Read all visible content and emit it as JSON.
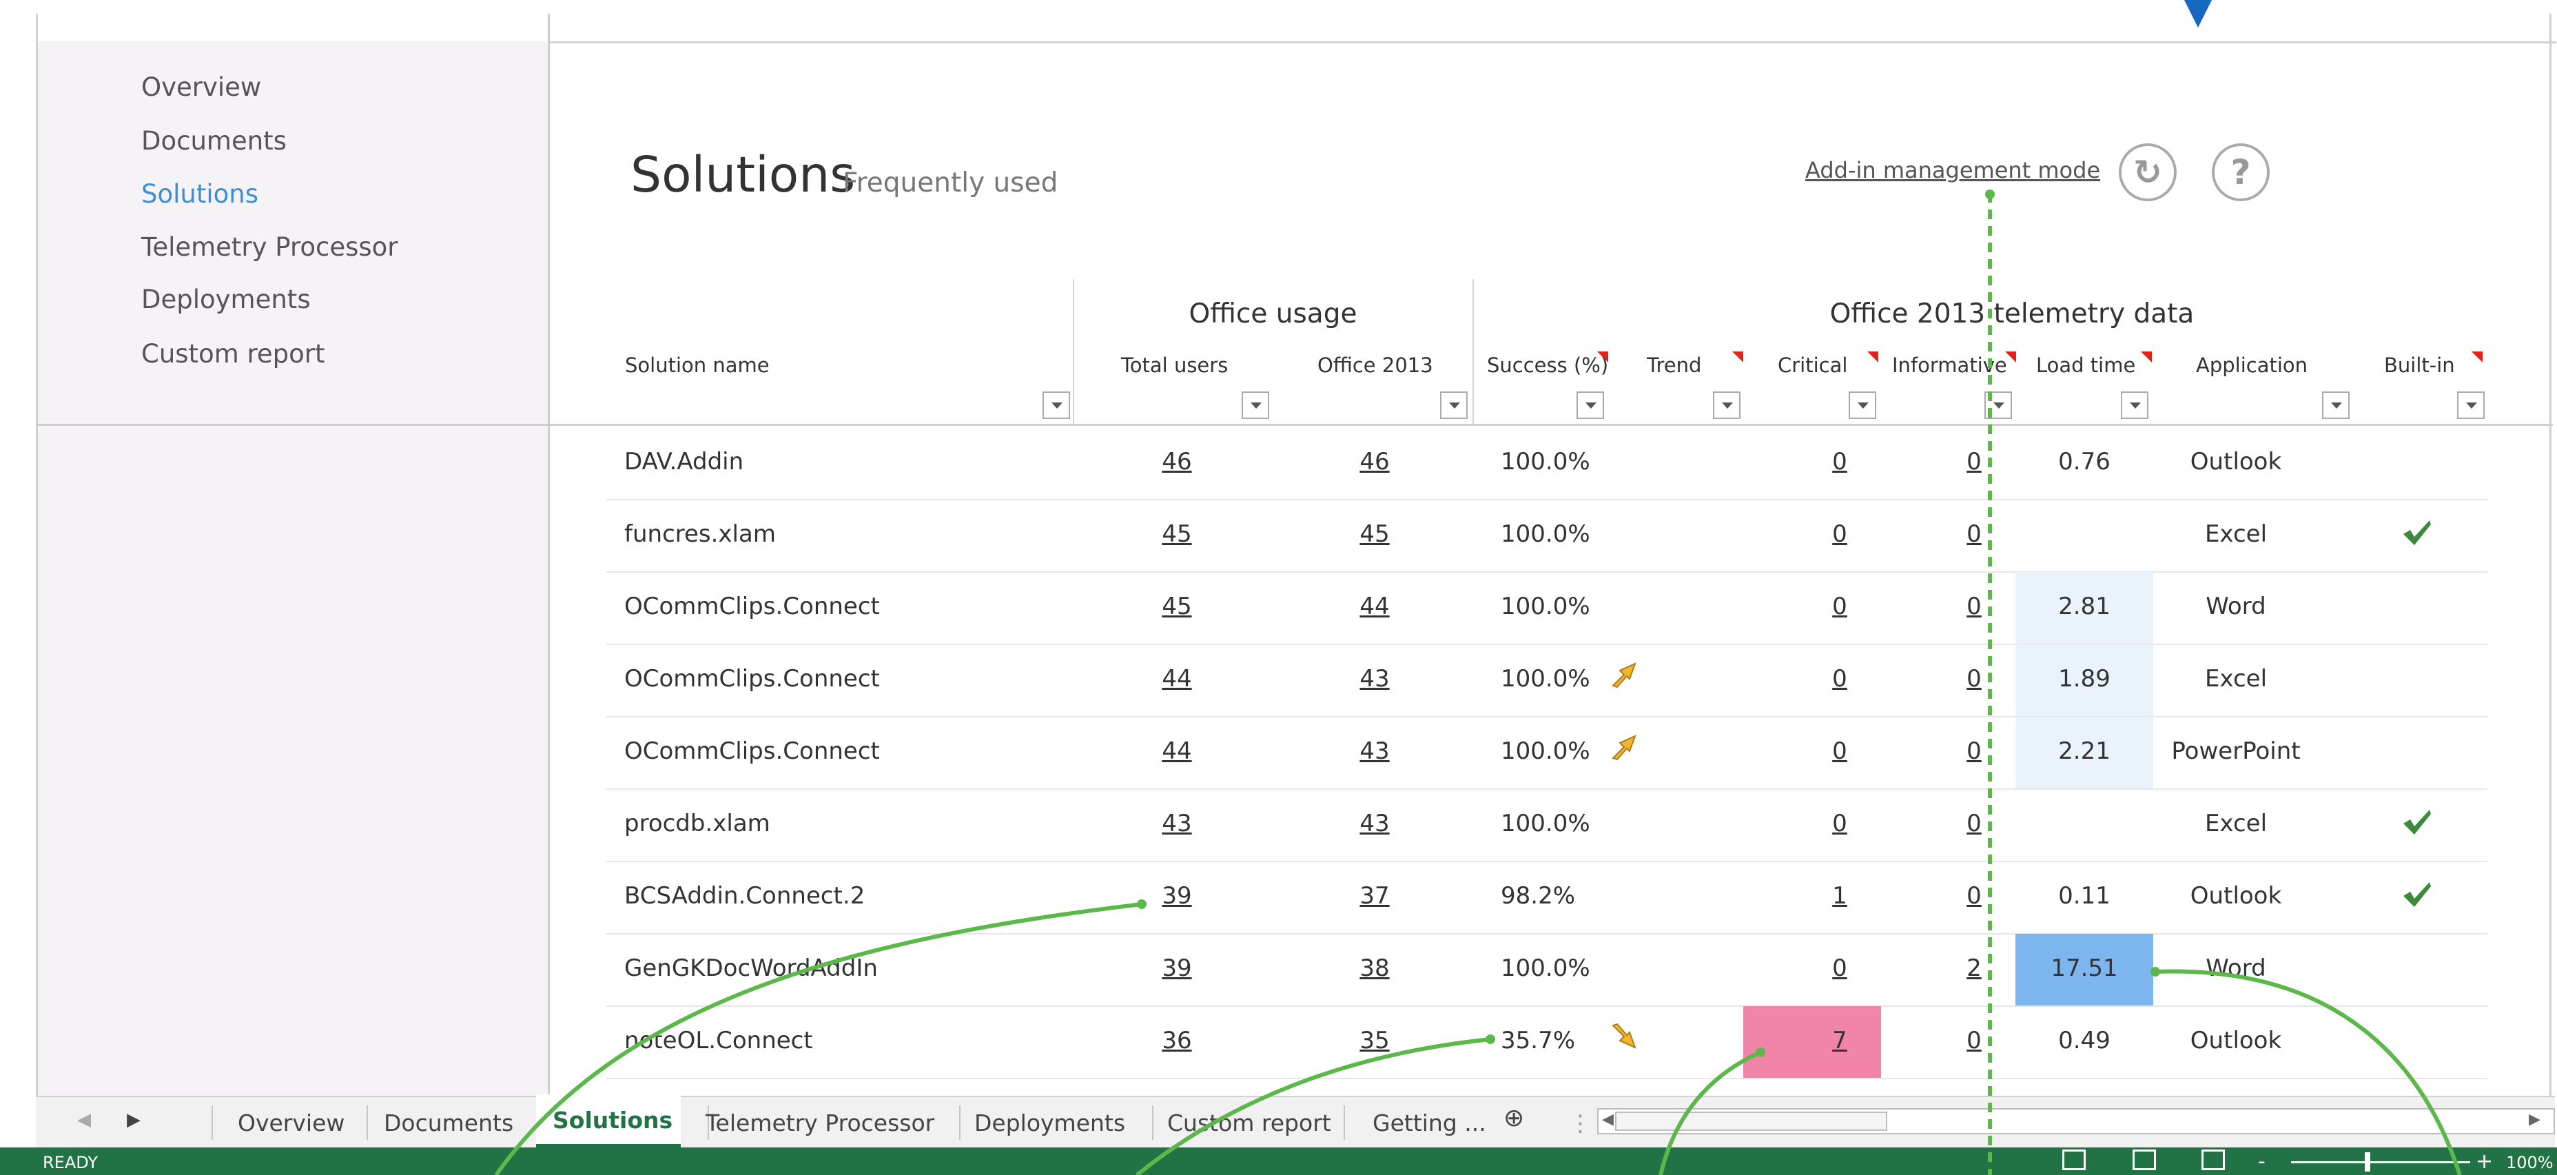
{
  "nav": {
    "items": [
      {
        "label": "Overview",
        "active": false
      },
      {
        "label": "Documents",
        "active": false
      },
      {
        "label": "Solutions",
        "active": true
      },
      {
        "label": "Telemetry Processor",
        "active": false
      },
      {
        "label": "Deployments",
        "active": false
      },
      {
        "label": "Custom report",
        "active": false
      }
    ]
  },
  "header": {
    "title": "Solutions",
    "subtitle": "Frequently used",
    "addin_mode_link": "Add-in management mode",
    "refresh_icon": "refresh-icon",
    "help_icon": "help-icon",
    "help_glyph": "?",
    "refresh_glyph": "↻"
  },
  "table": {
    "group_usage": "Office usage",
    "group_telemetry": "Office 2013 telemetry data",
    "columns": {
      "solution": "Solution name",
      "total_users": "Total users",
      "office2013": "Office 2013",
      "success": "Success (%)",
      "trend": "Trend",
      "critical": "Critical",
      "informative": "Informative",
      "load_time": "Load time",
      "application": "Application",
      "builtin": "Built-in"
    },
    "rows": [
      {
        "name": "DAV.Addin",
        "total": "46",
        "o2013": "46",
        "success": "100.0%",
        "trend": "",
        "critical": "0",
        "informative": "0",
        "load": "0.76",
        "app": "Outlook",
        "builtin": false
      },
      {
        "name": "funcres.xlam",
        "total": "45",
        "o2013": "45",
        "success": "100.0%",
        "trend": "",
        "critical": "0",
        "informative": "0",
        "load": "",
        "app": "Excel",
        "builtin": true
      },
      {
        "name": "OCommClips.Connect",
        "total": "45",
        "o2013": "44",
        "success": "100.0%",
        "trend": "",
        "critical": "0",
        "informative": "0",
        "load": "2.81",
        "app": "Word",
        "builtin": false
      },
      {
        "name": "OCommClips.Connect",
        "total": "44",
        "o2013": "43",
        "success": "100.0%",
        "trend": "up",
        "critical": "0",
        "informative": "0",
        "load": "1.89",
        "app": "Excel",
        "builtin": false
      },
      {
        "name": "OCommClips.Connect",
        "total": "44",
        "o2013": "43",
        "success": "100.0%",
        "trend": "up",
        "critical": "0",
        "informative": "0",
        "load": "2.21",
        "app": "PowerPoint",
        "builtin": false
      },
      {
        "name": "procdb.xlam",
        "total": "43",
        "o2013": "43",
        "success": "100.0%",
        "trend": "",
        "critical": "0",
        "informative": "0",
        "load": "",
        "app": "Excel",
        "builtin": true
      },
      {
        "name": "BCSAddin.Connect.2",
        "total": "39",
        "o2013": "37",
        "success": "98.2%",
        "trend": "",
        "critical": "1",
        "informative": "0",
        "load": "0.11",
        "app": "Outlook",
        "builtin": true
      },
      {
        "name": "GenGKDocWordAddIn",
        "total": "39",
        "o2013": "38",
        "success": "100.0%",
        "trend": "",
        "critical": "0",
        "informative": "2",
        "load": "17.51",
        "app": "Word",
        "builtin": false
      },
      {
        "name": "noteOL.Connect",
        "total": "36",
        "o2013": "35",
        "success": "35.7%",
        "trend": "down",
        "critical": "7",
        "informative": "0",
        "load": "0.49",
        "app": "Outlook",
        "builtin": false
      }
    ]
  },
  "tabs": {
    "items": [
      "Overview",
      "Documents",
      "Solutions",
      "Telemetry Processor",
      "Deployments",
      "Custom report",
      "Getting ..."
    ],
    "active": "Solutions"
  },
  "status": {
    "ready": "READY",
    "zoom": "100%",
    "zoom_minus": "-",
    "zoom_plus": "+"
  },
  "colors": {
    "accent_blue": "#3a8fd9",
    "status_green": "#217346",
    "critical_pink": "#f084a9",
    "load_highlight": "#7db6ef",
    "load_light": "#eaf2fc",
    "arrow_green": "#5cb84a",
    "arrow_orange": "#f3b52f",
    "check_green": "#3c8a3c"
  }
}
